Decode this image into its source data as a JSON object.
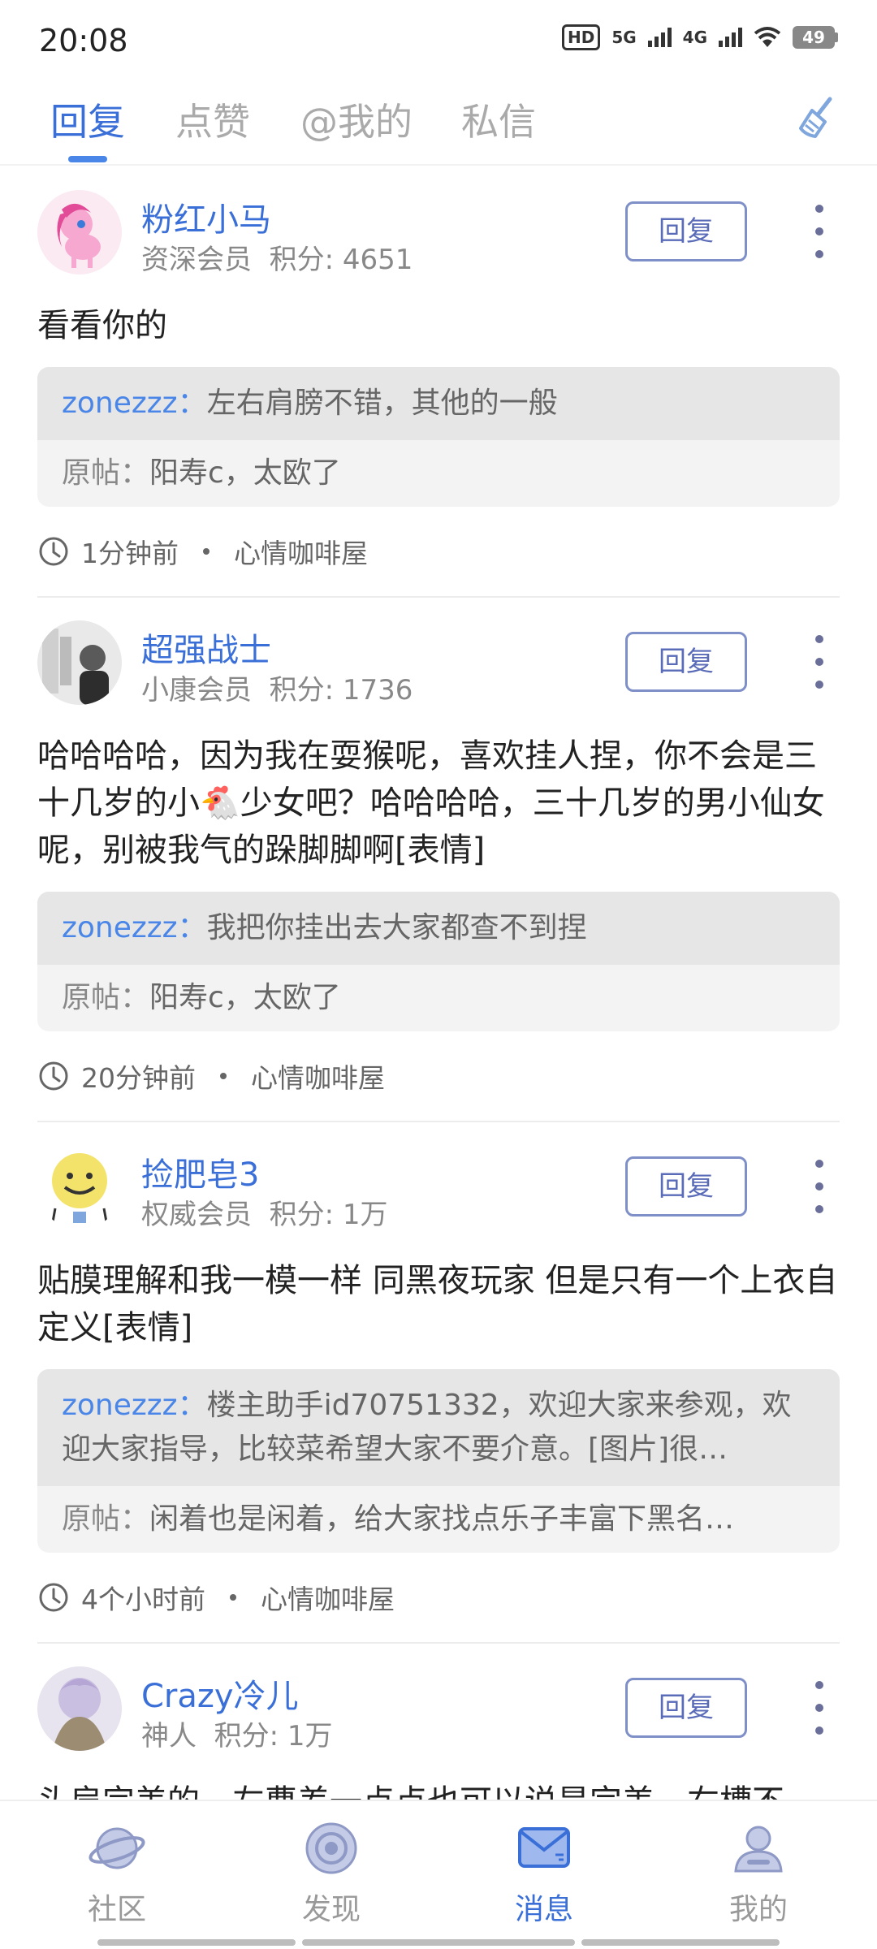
{
  "status_bar": {
    "time": "20:08",
    "hd_label": "HD",
    "net1": "5G",
    "net2": "4G",
    "battery": "49"
  },
  "tabs": [
    {
      "label": "回复",
      "active": true
    },
    {
      "label": "点赞",
      "active": false
    },
    {
      "label": "@我的",
      "active": false
    },
    {
      "label": "私信",
      "active": false
    }
  ],
  "clear_icon": "broom-icon",
  "posts": [
    {
      "username": "粉红小马",
      "meta": "资深会员  积分: 4651",
      "reply_label": "回复",
      "content": "看看你的",
      "quote_user": "zonezzz：",
      "quote_text": "左右肩膀不错，其他的一般",
      "origin_label": "原帖：",
      "origin_text": "阳寿c，太欧了",
      "time": "1分钟前",
      "forum": "心情咖啡屋"
    },
    {
      "username": "超强战士",
      "meta": "小康会员  积分: 1736",
      "reply_label": "回复",
      "content": "哈哈哈哈，因为我在耍猴呢，喜欢挂人捏，你不会是三十几岁的小🐔少女吧？哈哈哈哈，三十几岁的男小仙女呢，别被我气的跺脚脚啊[表情]",
      "quote_user": "zonezzz：",
      "quote_text": "我把你挂出去大家都查不到捏",
      "origin_label": "原帖：",
      "origin_text": "阳寿c，太欧了",
      "time": "20分钟前",
      "forum": "心情咖啡屋"
    },
    {
      "username": "捡肥皂3",
      "meta": "权威会员  积分: 1万",
      "reply_label": "回复",
      "content": "贴膜理解和我一模一样 同黑夜玩家 但是只有一个上衣自定义[表情]",
      "quote_user": "zonezzz：",
      "quote_text": "楼主助手id70751332，欢迎大家来参观，欢迎大家指导，比较菜希望大家不要介意。[图片]很…",
      "origin_label": "原帖：",
      "origin_text": "闲着也是闲着，给大家找点乐子丰富下黑名…",
      "time": "4个小时前",
      "forum": "心情咖啡屋"
    },
    {
      "username": "Crazy冷儿",
      "meta": "神人  积分: 1万",
      "reply_label": "回复",
      "content": "头肩完美的，左曹差一点点也可以说是完美，右槽不"
    }
  ],
  "bottom_nav": [
    {
      "label": "社区",
      "icon": "planet-icon",
      "active": false
    },
    {
      "label": "发现",
      "icon": "target-icon",
      "active": false
    },
    {
      "label": "消息",
      "icon": "mail-icon",
      "active": true
    },
    {
      "label": "我的",
      "icon": "user-icon",
      "active": false
    }
  ],
  "colors": {
    "accent": "#3a6fd8",
    "link_blue": "#4a86e8",
    "button_border": "#7f8fc8"
  }
}
